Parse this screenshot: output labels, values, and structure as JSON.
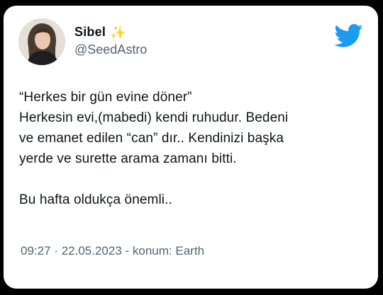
{
  "tweet": {
    "author": {
      "display_name": "Sibel",
      "name_emoji": "✨",
      "handle": "@SeedAstro",
      "avatar_icon": "profile-photo"
    },
    "brand": {
      "icon": "twitter-bird-icon",
      "color": "#1d9bf0"
    },
    "text_lines": [
      "“Herkes bir gün evine döner”",
      "Herkesin evi,(mabedi) kendi ruhudur. Bedeni",
      "ve emanet edilen “can” dır.. Kendinizi başka",
      "yerde ve surette arama zamanı bitti.",
      "",
      "Bu hafta oldukça önemli.."
    ],
    "meta": {
      "time": "09:27",
      "separator": "·",
      "date": "22.05.2023",
      "location_prefix": "- konum:",
      "location": "Earth"
    }
  },
  "colors": {
    "text_primary": "#0f1419",
    "text_secondary": "#536471",
    "background": "#ffffff",
    "frame": "#000000"
  }
}
